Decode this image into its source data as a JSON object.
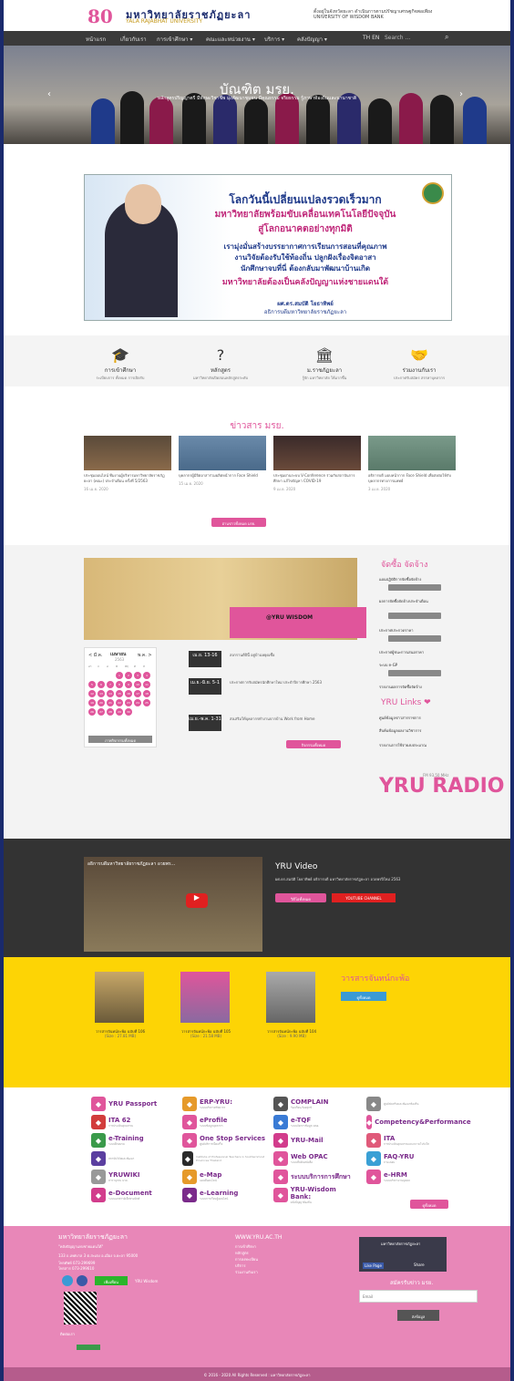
{
  "header": {
    "logo_number": "80",
    "logo_title": "มหาวิทยาลัยราชภัฏยะลา",
    "logo_subtitle": "YALA RAJABHAT UNIVERSITY",
    "right_text": "ตั้งอยู่ในจังหวัดยะลา ดำเนินการตามปรัชญาเศรษฐกิจพอเพียง UNIVERSITY OF WISDOM BANK"
  },
  "nav": {
    "items": [
      "หน้าแรก",
      "เกี่ยวกับเรา",
      "การเข้าศึกษา ▾",
      "คณะและหน่วยงาน ▾",
      "บริการ ▾",
      "คลังปัญญา ▾"
    ],
    "search_placeholder": "Search ...",
    "lang": "TH EN"
  },
  "hero": {
    "title": "บัณฑิต มรย.",
    "subtitle": "หลักสูตรปริญญาตรี มีทักษะวิชาชีพ มุ่งพัฒนาชุมชน มีคุณธรรม จริยธรรม รู้ภาษาท้องถิ่นและนานาชาติ"
  },
  "banner": {
    "l1": "โลกวันนี้เปลี่ยนแปลงรวดเร็วมาก",
    "l2": "มหาวิทยาลัยพร้อมขับเคลื่อนเทคโนโลยีปัจจุบัน",
    "l3": "สู่โลกอนาคตอย่างทุกมิติ",
    "l4": "เรามุ่งมั่นสร้างบรรยากาศการเรียนการสอนที่คุณภาพ",
    "l5": "งานวิจัยต้องรับใช้ท้องถิ่น ปลูกฝังเรื่องจิตอาสา",
    "l6": "นักศึกษาจบที่นี่ ต้องกลับมาพัฒนาบ้านเกิด",
    "l7": "มหาวิทยาลัยต้องเป็นคลังปัญญาแห่งชายแดนใต้",
    "name": "ผศ.ดร.สมบัติ โยธาทิพย์",
    "role": "อธิการบดีมหาวิทยาลัยราชภัฏยะลา"
  },
  "icons": [
    {
      "icon": "graduation-cap-icon",
      "glyph": "🎓",
      "title": "การเข้าศึกษา",
      "sub": "ระเบียบการ ทั้งหมด การเปิดรับ"
    },
    {
      "icon": "question-icon",
      "glyph": "?",
      "title": "หลักสูตร",
      "sub": "มหาวิทยาลัยเปิดสอนหลักสูตรระดับ"
    },
    {
      "icon": "institution-icon",
      "glyph": "🏛",
      "title": "ม.ราชภัฏยะลา",
      "sub": "รู้จัก มหาวิทยาลัย ให้มากขึ้น"
    },
    {
      "icon": "handshake-icon",
      "glyph": "🤝",
      "title": "ร่วมงานกับเรา",
      "sub": "ประกาศรับสมัคร สรรหาบุคลากร"
    }
  ],
  "news": {
    "title": "ข่าวสาร มรย.",
    "items": [
      {
        "text": "ประชุมออนไลน์ ทีมงานผู้บริหารมหาวิทยาลัยราชภัฏยะลา (คณะ) ประจำเดือน ครั้งที่ 5/2563",
        "date": "16 เม.ย. 2020"
      },
      {
        "text": "บุคลากรผู้มีจิตอาสาร่วมผลิตหน้ากาก Face Shield",
        "date": "15 เม.ย. 2020"
      },
      {
        "text": "ประชุมผ่านระบบ V-Conference ร่วมกับสถาบันการศึกษา แก้ไขปัญหา COVID-19",
        "date": "9 เม.ย. 2020"
      },
      {
        "text": "อธิการบดี มอบหน้ากาก Face Shield เพื่อส่งต่อให้กับบุคลากรทางการแพทย์",
        "date": "3 เม.ย. 2020"
      }
    ],
    "more": "อ่านข่าวทั้งหมด มรย."
  },
  "events": {
    "badge": "@YRU WISDOM",
    "cal_month": "เมษายน",
    "cal_year": "2563",
    "cal_prev": "< มี.ค.",
    "cal_next": "พ.ค. >",
    "cal_days": [
      "อา",
      "จ",
      "อ",
      "พ",
      "พฤ",
      "ศ",
      "ส"
    ],
    "cal_button": "ภาพกิจกรรมทั้งหมด",
    "dates": [
      {
        "d": "เม.ย. 13-16",
        "t": "สงกรานต์ปีนี้ อยู่บ้านหยุดเชื้อ"
      },
      {
        "d": "เม.ย.-มิ.ย. 5-1",
        "t": "ประกาศการรับสมัครนักศึกษาใหม่ ประจำปีการศึกษา 2563"
      },
      {
        "d": "เม.ย.-พ.ค. 1-31",
        "t": "ส่งเสริมให้บุคลากรทำงานจากบ้าน Work from Home"
      }
    ],
    "more": "กิจกรรมทั้งหมด"
  },
  "procure": {
    "title": "จัดซื้อ จัดจ้าง",
    "items": [
      "แผนปฏิบัติการจัดซื้อจัดจ้าง",
      "ผลการจัดซื้อจัดจ้างประจำเดือน",
      "ประกาศประกวดราคา",
      "ประกาศผู้ชนะการเสนอราคา",
      "ระบบ e-GP",
      "รายงานผลการจัดซื้อจัดจ้าง"
    ],
    "select": "เลือกปีงบประมาณ"
  },
  "yrulinks": {
    "title": "YRU Links ❤",
    "items": [
      "ศูนย์ข้อมูลข่าวสารราชการ",
      "สืบค้นข้อมูลผลงานวิชาการ",
      "รายงานการใช้จ่ายงบประมาณ"
    ]
  },
  "radio": {
    "label": "YRU RADIO",
    "freq": "FM 93.50 MHz"
  },
  "video": {
    "title": "YRU Video",
    "desc": "ผศ.ดร.สมบัติ โยธาทิพย์ อธิการบดี มหาวิทยาลัยราชภัฏยะลา อวยพรปีใหม่ 2563",
    "more": "วิดีโอทั้งหมด",
    "channel": "YOUTUBE CHANNEL",
    "thumb_title": "อธิการบดีมหาวิทยาลัยราชภัฏยะลา อวยพร..."
  },
  "journal": {
    "title": "วารสารจันทน์กะพ้อ",
    "more": "ดูทั้งหมด",
    "items": [
      {
        "t": "วารสารจันทน์กะพ้อ ฉบับที่ 106",
        "s": "(Size : 27.81 MB)"
      },
      {
        "t": "วารสารจันทน์กะพ้อ ฉบับที่ 105",
        "s": "(Size : 21.58 MB)"
      },
      {
        "t": "วารสารจันทน์กะพ้อ ฉบับที่ 104",
        "s": "(Size : 9.90 MB)"
      }
    ]
  },
  "links": {
    "items": [
      {
        "icon": "passport-icon",
        "t": "YRU Passport",
        "s": "",
        "c": "#e0559b"
      },
      {
        "icon": "erp-icon",
        "t": "ERP-YRU:",
        "s": "ระบบบริหารทรัพยากร",
        "c": "#e69a2a"
      },
      {
        "icon": "megaphone-icon",
        "t": "COMPLAIN",
        "s": "ร้องเรียน/ร้องทุกข์",
        "c": "#555"
      },
      {
        "icon": "center-icon",
        "t": "",
        "s": "ศูนย์ส่งเสริมและพัฒนาท้องถิ่น",
        "c": "#888"
      },
      {
        "icon": "ita-icon",
        "t": "ITA 62",
        "s": "การประเมินคุณธรรม",
        "c": "#d23c3c"
      },
      {
        "icon": "eprofile-icon",
        "t": "eProfile",
        "s": "ระบบข้อมูลบุคลากร",
        "c": "#e0559b"
      },
      {
        "icon": "etqf-icon",
        "t": "e-TQF",
        "s": "ระบบจัดการข้อมูล มคอ.",
        "c": "#3a7bd5"
      },
      {
        "icon": "competency-icon",
        "t": "Competency&Performance",
        "s": "",
        "c": "#e0559b"
      },
      {
        "icon": "training-icon",
        "t": "e-Training",
        "s": "ระบบฝึกอบรม",
        "c": "#3a9a4a"
      },
      {
        "icon": "onestop-icon",
        "t": "One Stop Services",
        "s": "ศูนย์บริการเบ็ดเสร็จ",
        "c": "#e0559b"
      },
      {
        "icon": "mail-icon",
        "t": "YRU-Mail",
        "s": "",
        "c": "#d23c8c"
      },
      {
        "icon": "ita2-icon",
        "t": "ITA",
        "s": "การประเมินคุณธรรมและความโปร่งใส",
        "c": "#e05a7a"
      },
      {
        "icon": "research-icon",
        "t": "",
        "s": "สถาบันวิจัยและพัฒนา",
        "c": "#5b3fa0"
      },
      {
        "icon": "inst-icon",
        "t": "",
        "s": "Institute of Professional Teachers in Southernmost Provinces Thailand",
        "c": "#2a2a2a"
      },
      {
        "icon": "opac-icon",
        "t": "Web OPAC",
        "s": "ระบบสืบค้นหนังสือ",
        "c": "#e0559b"
      },
      {
        "icon": "faq-icon",
        "t": "FAQ-YRU",
        "s": "ถาม-ตอบ",
        "c": "#3aa0d5"
      },
      {
        "icon": "wiki-icon",
        "t": "YRUWIKI",
        "s": "สารานุกรม มรย.",
        "c": "#999"
      },
      {
        "icon": "emap-icon",
        "t": "e-Map",
        "s": "แผนที่ออนไลน์",
        "c": "#e69a2a"
      },
      {
        "icon": "edu-icon",
        "t": "ระบบบริการการศึกษา",
        "s": "",
        "c": "#e0559b"
      },
      {
        "icon": "ehrm-icon",
        "t": "e-HRM",
        "s": "ระบบบริหารงานบุคคล",
        "c": "#e0559b"
      },
      {
        "icon": "edoc-icon",
        "t": "e-Document",
        "s": "ระบบเอกสารอิเล็กทรอนิกส์",
        "c": "#d23c8c"
      },
      {
        "icon": "elearn-icon",
        "t": "e-Learning",
        "s": "ระบบการเรียนรู้ออนไลน์",
        "c": "#7a2a8a"
      },
      {
        "icon": "wisdom-icon",
        "t": "YRU-Wisdom Bank:",
        "s": "คลังปัญญาท้องถิ่น",
        "c": "#e0559b"
      }
    ],
    "more": "ดูทั้งหมด"
  },
  "footer": {
    "univ": "มหาวิทยาลัยราชภัฏยะลา",
    "slogan": "\"คลังปัญญาแห่งชายแดนใต้\"",
    "address": "133 ถ.เทศบาล 3 ต.สะเตง อ.เมือง จ.ยะลา 95000",
    "phone": "โทรศัพท์ 073-299699",
    "fax": "โทรสาร 073-299610",
    "links_title": "WWW.YRU.AC.TH",
    "links": [
      "การเข้าศึกษา",
      "หลักสูตร",
      "การลงทะเบียน",
      "บริการ",
      "ร่วมงานกับเรา"
    ],
    "fb_name": "มหาวิทยาลัยราชภัฏยะลา",
    "fb_like": "Like Page",
    "fb_share": "Share",
    "subscribe": "สมัครรับข่าว มรย.",
    "email_placeholder": "Email",
    "send": "ส่งข้อมูล",
    "line": "เพิ่มเพื่อน",
    "contact": "YRU Wisdom",
    "stats": "ติดต่อเรา"
  },
  "copyright": "© 2016 - 2020 All Rights Reserved : มหาวิทยาลัยราชภัฏยะลา"
}
